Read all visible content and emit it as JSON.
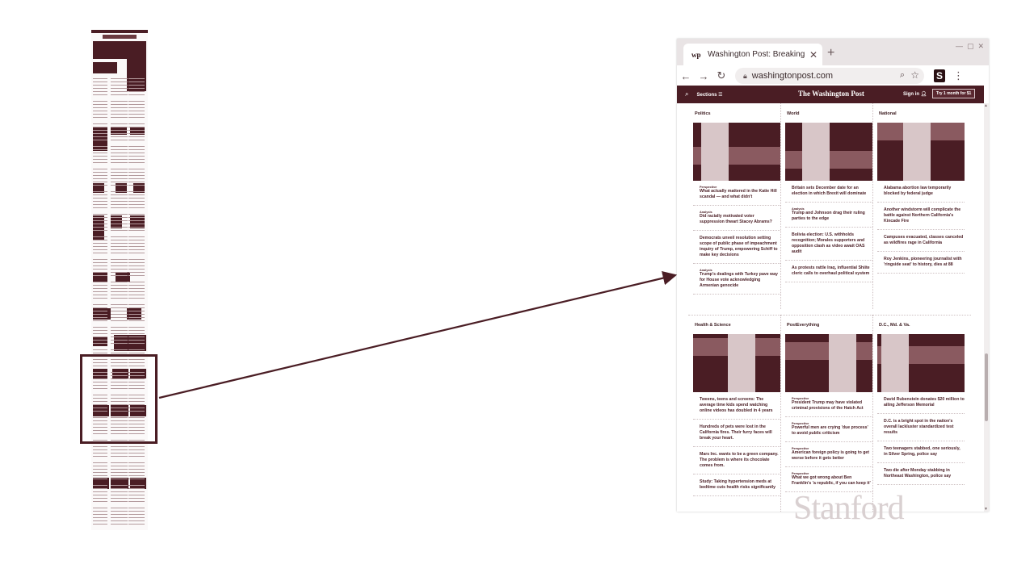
{
  "browser": {
    "tab_title": "Washington Post: Breaking News",
    "tab_favicon": "wp",
    "url": "washingtonpost.com",
    "extension_letter": "S"
  },
  "wp_header": {
    "sections_label": "Sections",
    "logo": "The Washington Post",
    "sign_in": "Sign in",
    "subscribe": "Try 1 month for $1"
  },
  "sections": [
    {
      "title": "Politics",
      "stories": [
        {
          "kicker": "Perspective",
          "headline": "What actually mattered in the Katie Hill scandal — and what didn't"
        },
        {
          "kicker": "Analysis",
          "headline": "Did racially motivated voter suppression thwart Stacey Abrams?"
        },
        {
          "kicker": "",
          "headline": "Democrats unveil resolution setting scope of public phase of impeachment inquiry of Trump, empowering Schiff to make key decisions"
        },
        {
          "kicker": "Analysis",
          "headline": "Trump's dealings with Turkey pave way for House vote acknowledging Armenian genocide"
        }
      ]
    },
    {
      "title": "World",
      "stories": [
        {
          "kicker": "",
          "headline": "Britain sets December date for an election in which Brexit will dominate"
        },
        {
          "kicker": "Analysis",
          "headline": "Trump and Johnson drag their ruling parties to the edge"
        },
        {
          "kicker": "",
          "headline": "Bolivia election: U.S. withholds recognition; Morales supporters and opposition clash as video await OAS audit"
        },
        {
          "kicker": "",
          "headline": "As protests rattle Iraq, influential Shiite cleric calls to overhaul political system"
        }
      ]
    },
    {
      "title": "National",
      "stories": [
        {
          "kicker": "",
          "headline": "Alabama abortion law temporarily blocked by federal judge"
        },
        {
          "kicker": "",
          "headline": "Another windstorm will complicate the battle against Northern California's Kincade Fire"
        },
        {
          "kicker": "",
          "headline": "Campuses evacuated, classes canceled as wildfires rage in California"
        },
        {
          "kicker": "",
          "headline": "Roy Jenkins, pioneering journalist with 'ringside seat' to history, dies at 88"
        }
      ]
    },
    {
      "title": "Health & Science",
      "stories": [
        {
          "kicker": "",
          "headline": "Tweens, teens and screens: The average time kids spend watching online videos has doubled in 4 years"
        },
        {
          "kicker": "",
          "headline": "Hundreds of pets were lost in the California fires. Their furry faces will break your heart."
        },
        {
          "kicker": "",
          "headline": "Mars Inc. wants to be a green company. The problem is where its chocolate comes from."
        },
        {
          "kicker": "",
          "headline": "Study: Taking hypertension meds at bedtime cuts health risks significantly"
        }
      ]
    },
    {
      "title": "PostEverything",
      "stories": [
        {
          "kicker": "Perspective",
          "headline": "President Trump may have violated criminal provisions of the Hatch Act"
        },
        {
          "kicker": "Perspective",
          "headline": "Powerful men are crying 'due process' to avoid public criticism"
        },
        {
          "kicker": "Perspective",
          "headline": "American foreign policy is going to get worse before it gets better"
        },
        {
          "kicker": "Perspective",
          "headline": "What we got wrong about Ben Franklin's 'a republic, if you can keep it'"
        }
      ]
    },
    {
      "title": "D.C., Md. & Va.",
      "stories": [
        {
          "kicker": "",
          "headline": "David Rubenstein donates $20 million to ailing Jefferson Memorial"
        },
        {
          "kicker": "",
          "headline": "D.C. is a bright spot in the nation's overall lackluster standardized test results"
        },
        {
          "kicker": "",
          "headline": "Two teenagers stabbed, one seriously, in Silver Spring, police say"
        },
        {
          "kicker": "",
          "headline": "Two die after Monday stabbing in Northeast Washington, police say"
        }
      ]
    }
  ],
  "watermark": "Stanford",
  "colors": {
    "accent": "#4a1d24",
    "watermark": "#d9d0d1"
  }
}
